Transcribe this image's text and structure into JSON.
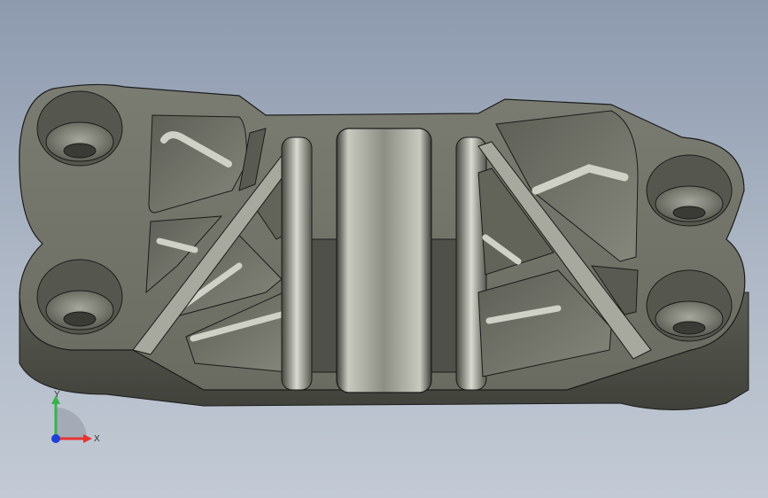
{
  "viewport": {
    "background_top": "#8d9aae",
    "background_bottom": "#c3cad5"
  },
  "model": {
    "material_color": "#6d6f65",
    "edge_color": "#1c1c1a",
    "highlight_color": "#c9cabf"
  },
  "triad": {
    "x_label": "X",
    "y_label": "Y",
    "x_color": "#e8332e",
    "y_color": "#38b24a",
    "z_color": "#1f3fd6",
    "x_icon": "arrow-right-icon",
    "y_icon": "arrow-up-icon"
  }
}
